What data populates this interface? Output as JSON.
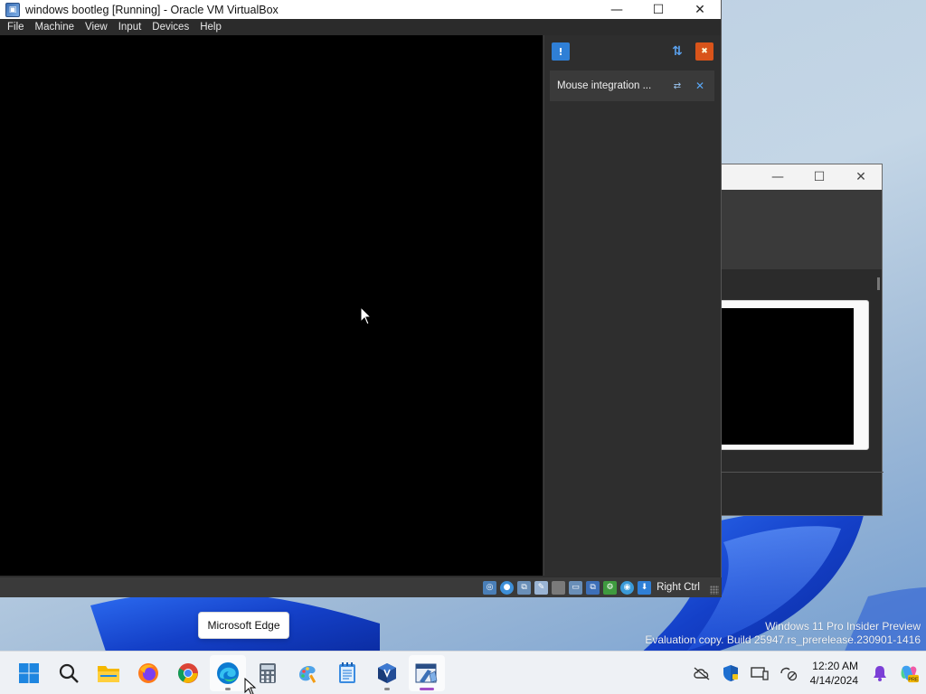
{
  "vbox": {
    "title": "windows bootleg [Running] - Oracle VM VirtualBox",
    "controls": {
      "minimize": "—",
      "maximize": "☐",
      "close": "✕"
    },
    "menu": [
      "File",
      "Machine",
      "View",
      "Input",
      "Devices",
      "Help"
    ],
    "notification": {
      "text": "Mouse integration ...",
      "help_icon": "help-icon",
      "close_icon": "close-icon"
    },
    "status": {
      "host_key": "Right Ctrl",
      "icons": [
        "hard-disk-icon",
        "optical-drive-icon",
        "audio-icon",
        "usb-icon",
        "shared-folders-icon",
        "display-icon",
        "video-capture-icon",
        "cpu-icon",
        "mouse-integration-icon",
        "keyboard-capture-icon"
      ]
    }
  },
  "tooltip": {
    "text": "Microsoft Edge"
  },
  "watermark": {
    "line1": "Windows 11 Pro Insider Preview",
    "line2": "Evaluation copy. Build 25947.rs_prerelease.230901-1416"
  },
  "taskbar": {
    "apps": [
      "start-button",
      "search",
      "file-explorer",
      "firefox",
      "chrome",
      "microsoft-edge",
      "calculator",
      "paint",
      "notepad",
      "virtualbox-manager",
      "virtualbox-vm"
    ],
    "clock": {
      "time": "12:20 AM",
      "date": "4/14/2024"
    }
  },
  "colors": {
    "vbox_dark": "#2d2d2d",
    "accent_blue": "#2f7fd6",
    "wallpaper_blue": "#1a4fd6"
  }
}
